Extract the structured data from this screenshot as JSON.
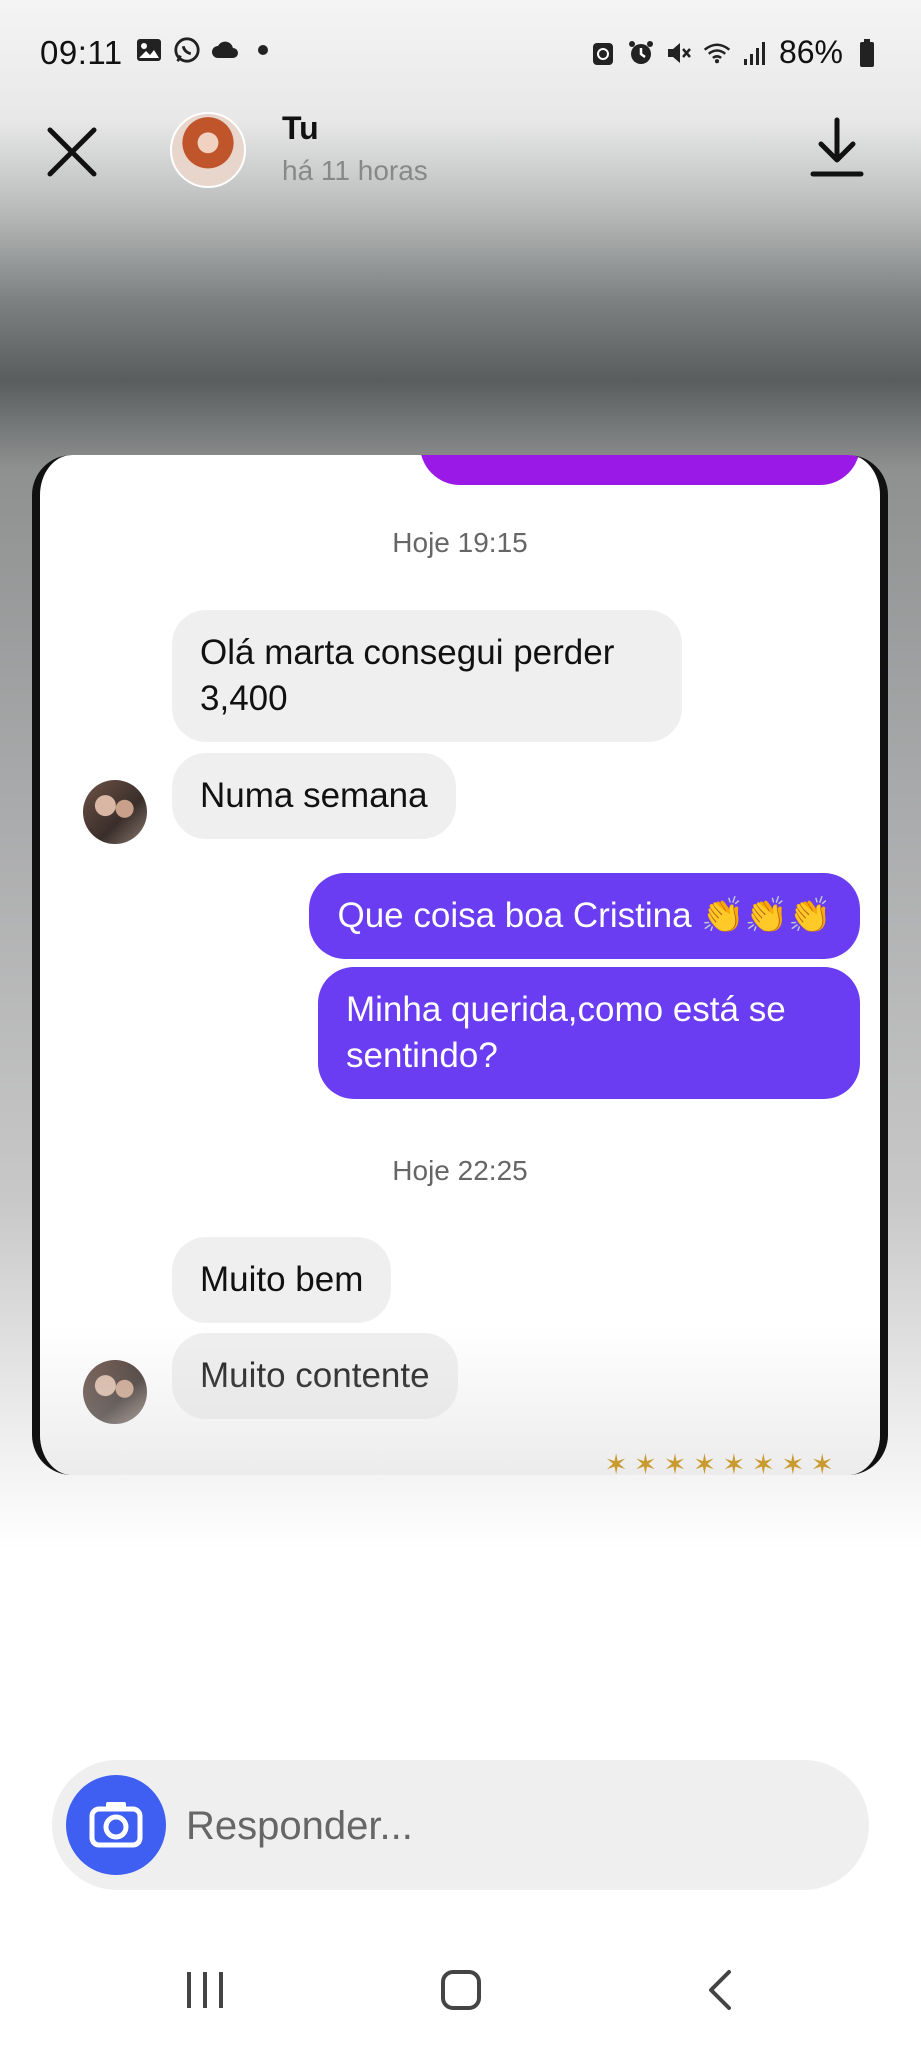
{
  "status": {
    "time": "09:11",
    "battery": "86%",
    "left_icons": [
      "image-icon",
      "whatsapp-icon",
      "cloud-icon",
      "dot-icon"
    ],
    "right_icons": [
      "recycle-icon",
      "alarm-icon",
      "mute-icon",
      "wifi-icon",
      "signal-icon",
      "battery-icon"
    ]
  },
  "header": {
    "user": "Tu",
    "time_ago": "há 11 horas"
  },
  "chat": {
    "timestamp1": "Hoje 19:15",
    "msg1": "Olá marta consegui perder 3,400",
    "msg2": "Numa semana",
    "msg3": "Que coisa boa Cristina 👏👏👏",
    "msg4": "Minha querida,como está se sentindo?",
    "timestamp2": "Hoje 22:25",
    "msg5": "Muito bem",
    "msg6": "Muito contente"
  },
  "reply": {
    "placeholder": "Responder..."
  },
  "colors": {
    "outgoing_bubble": "#6a3cf2",
    "top_bubble": "#9b19e6",
    "camera_button": "#3f5ef2"
  }
}
